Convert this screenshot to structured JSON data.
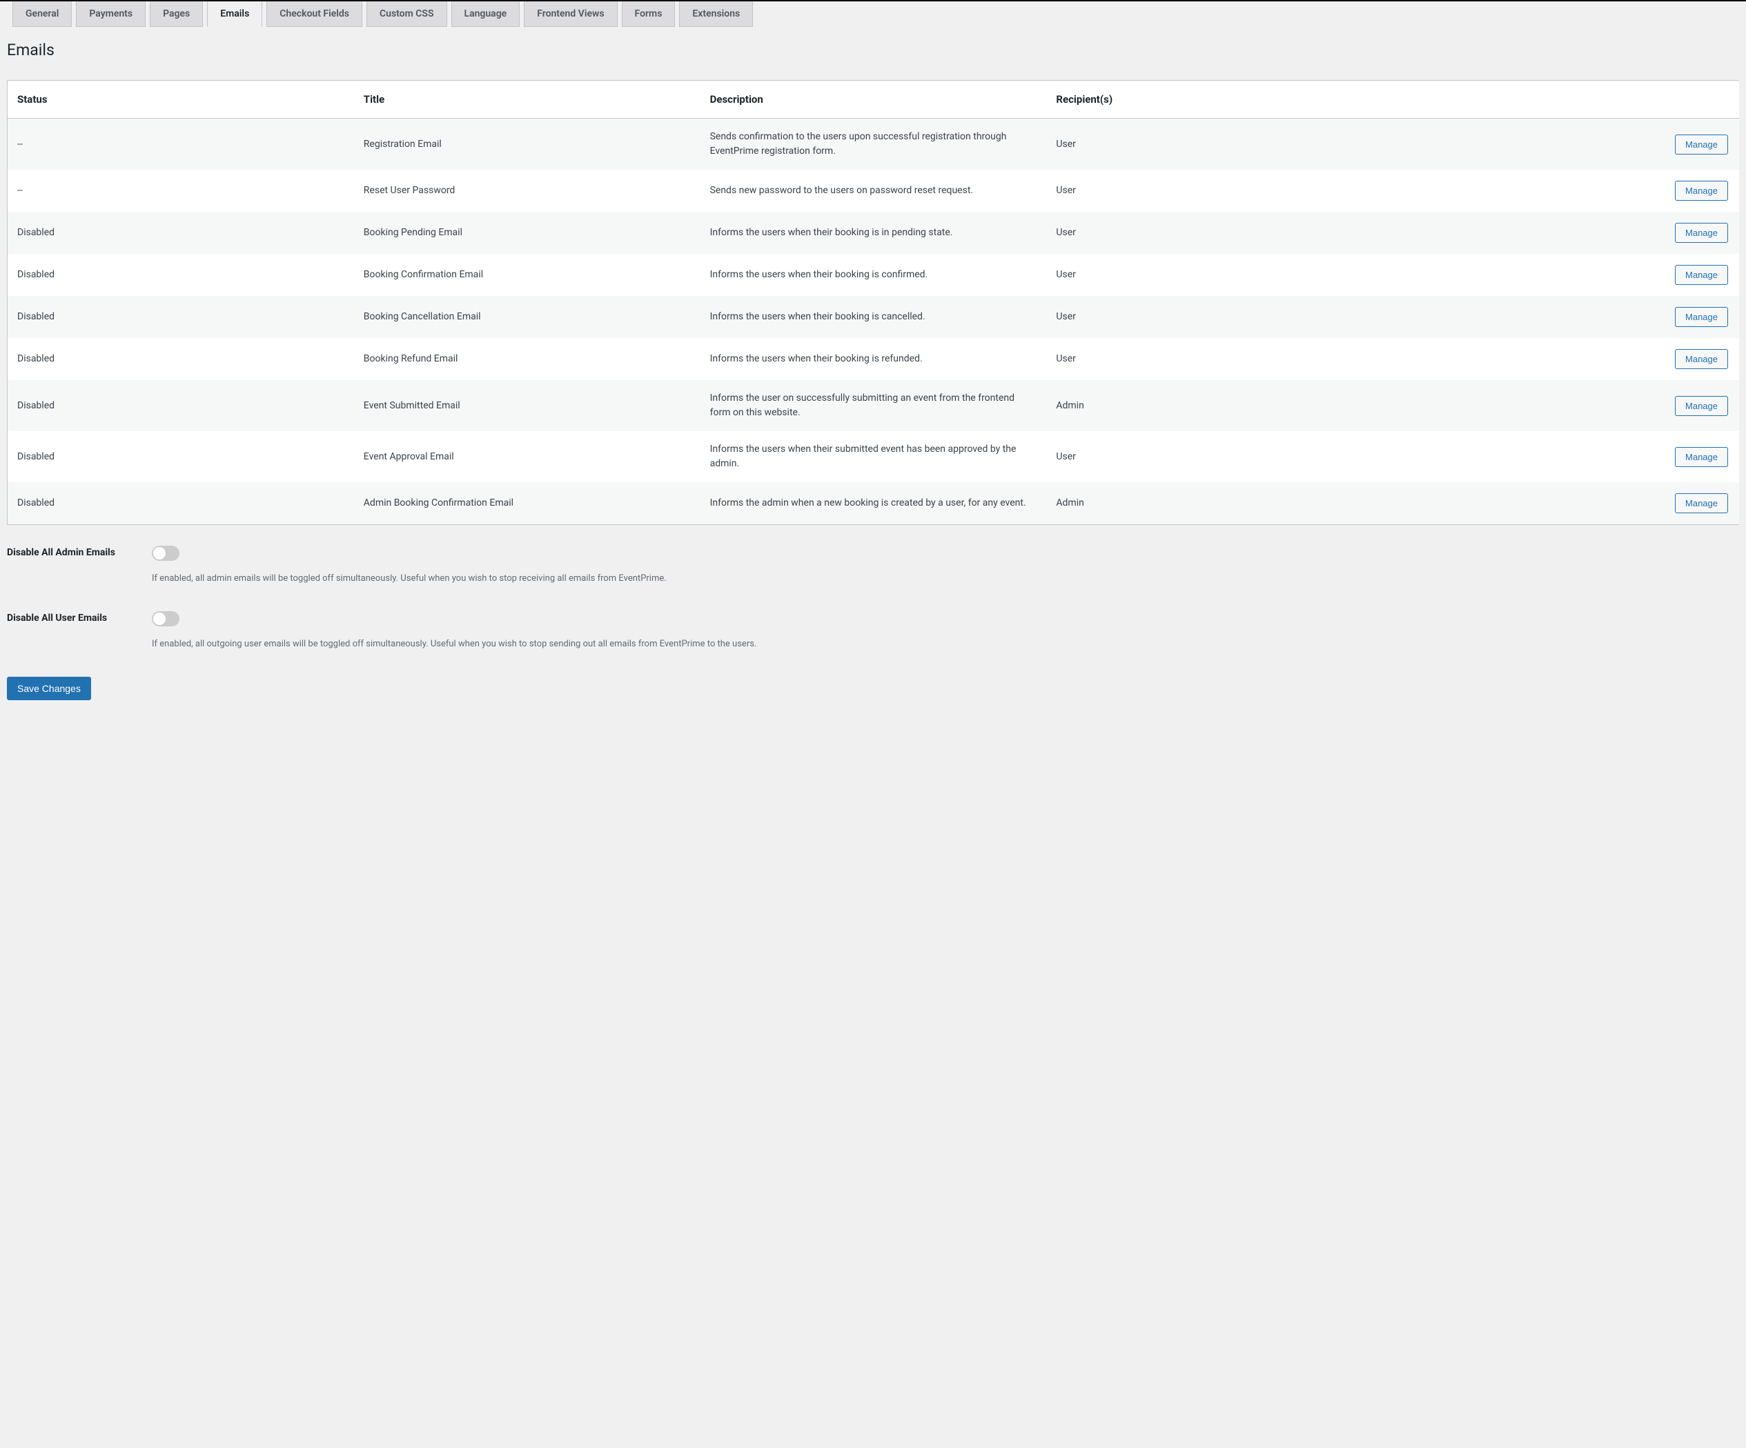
{
  "tabs": {
    "general": "General",
    "payments": "Payments",
    "pages": "Pages",
    "emails": "Emails",
    "checkout_fields": "Checkout Fields",
    "custom_css": "Custom CSS",
    "language": "Language",
    "frontend_views": "Frontend Views",
    "forms": "Forms",
    "extensions": "Extensions"
  },
  "page": {
    "title": "Emails"
  },
  "table": {
    "headers": {
      "status": "Status",
      "title": "Title",
      "description": "Description",
      "recipients": "Recipient(s)"
    },
    "manage_label": "Manage",
    "rows": [
      {
        "status": "--",
        "title": "Registration Email",
        "description": "Sends confirmation to the users upon successful registration through EventPrime registration form.",
        "recipients": "User"
      },
      {
        "status": "--",
        "title": "Reset User Password",
        "description": "Sends new password to the users on password reset request.",
        "recipients": "User"
      },
      {
        "status": "Disabled",
        "title": "Booking Pending Email",
        "description": "Informs the users when their booking is in pending state.",
        "recipients": "User"
      },
      {
        "status": "Disabled",
        "title": "Booking Confirmation Email",
        "description": "Informs the users when their booking is confirmed.",
        "recipients": "User"
      },
      {
        "status": "Disabled",
        "title": "Booking Cancellation Email",
        "description": "Informs the users when their booking is cancelled.",
        "recipients": "User"
      },
      {
        "status": "Disabled",
        "title": "Booking Refund Email",
        "description": "Informs the users when their booking is refunded.",
        "recipients": "User"
      },
      {
        "status": "Disabled",
        "title": "Event Submitted Email",
        "description": "Informs the user on successfully submitting an event from the frontend form on this website.",
        "recipients": "Admin"
      },
      {
        "status": "Disabled",
        "title": "Event Approval Email",
        "description": "Informs the users when their submitted event has been approved by the admin.",
        "recipients": "User"
      },
      {
        "status": "Disabled",
        "title": "Admin Booking Confirmation Email",
        "description": "Informs the admin when a new booking is created by a user, for any event.",
        "recipients": "Admin"
      }
    ]
  },
  "settings": {
    "disable_admin": {
      "label": "Disable All Admin Emails",
      "help": "If enabled, all admin emails will be toggled off simultaneously. Useful when you wish to stop receiving all emails from EventPrime."
    },
    "disable_user": {
      "label": "Disable All User Emails",
      "help": "If enabled, all outgoing user emails will be toggled off simultaneously. Useful when you wish to stop sending out all emails from EventPrime to the users."
    }
  },
  "buttons": {
    "save": "Save Changes"
  }
}
